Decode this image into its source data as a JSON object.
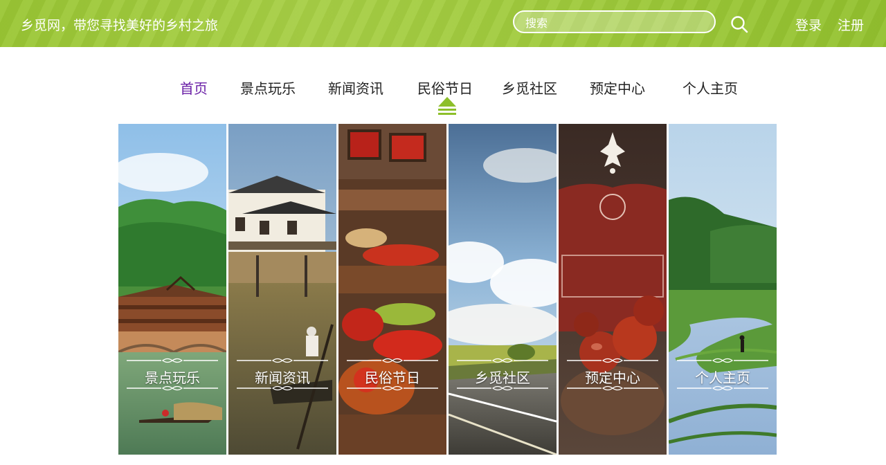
{
  "header": {
    "slogan": "乡觅网，带您寻找美好的乡村之旅",
    "search_placeholder": "搜索",
    "login": "登录",
    "register": "注册"
  },
  "nav": {
    "items": [
      {
        "label": "首页",
        "active": true
      },
      {
        "label": "景点玩乐",
        "active": false
      },
      {
        "label": "新闻资讯",
        "active": false
      },
      {
        "label": "民俗节日",
        "active": false
      },
      {
        "label": "乡觅社区",
        "active": false
      },
      {
        "label": "预定中心",
        "active": false
      },
      {
        "label": "个人主页",
        "active": false
      }
    ]
  },
  "panels": [
    {
      "label": "景点玩乐"
    },
    {
      "label": "新闻资讯"
    },
    {
      "label": "民俗节日"
    },
    {
      "label": "乡觅社区"
    },
    {
      "label": "预定中心"
    },
    {
      "label": "个人主页"
    }
  ],
  "colors": {
    "header_green": "#9ec93b",
    "nav_active": "#6a1fa6",
    "nav_text": "#222222",
    "indicator": "#8dbf2a"
  }
}
